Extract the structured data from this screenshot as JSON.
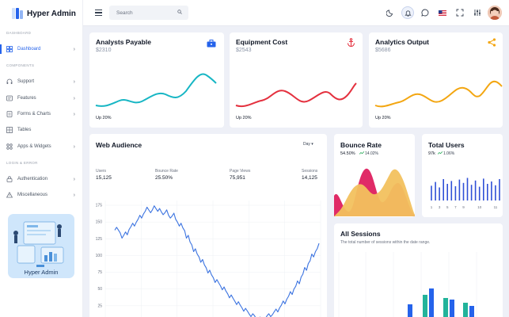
{
  "app": {
    "name": "Hyper Admin"
  },
  "sidebar": {
    "section_dashboard": "DASHBOARD",
    "section_components": "COMPONENTS",
    "section_login": "LOGIN & ERROR",
    "items": [
      {
        "label": "Dashboard",
        "icon": "dashboard-icon"
      },
      {
        "label": "Support",
        "icon": "headset-icon"
      },
      {
        "label": "Features",
        "icon": "features-icon"
      },
      {
        "label": "Forms & Charts",
        "icon": "forms-icon"
      },
      {
        "label": "Tables",
        "icon": "table-icon"
      },
      {
        "label": "Apps & Widgets",
        "icon": "apps-icon"
      },
      {
        "label": "Authentication",
        "icon": "lock-icon"
      },
      {
        "label": "Miscellaneous",
        "icon": "warning-icon"
      }
    ],
    "promo_title": "Hyper Admin"
  },
  "topbar": {
    "search_placeholder": "Search"
  },
  "cards": {
    "analysts": {
      "title": "Analysts Payable",
      "value": "$2310",
      "foot": "Up 20%",
      "color": "#17b6c4"
    },
    "equipment": {
      "title": "Equipment Cost",
      "value": "$2543",
      "foot": "Up 20%",
      "color": "#e4313f"
    },
    "analytics": {
      "title": "Analytics Output",
      "value": "$5686",
      "foot": "Up 20%",
      "color": "#f3a611"
    }
  },
  "web_audience": {
    "title": "Web Audience",
    "range": "Day",
    "stats": [
      {
        "label": "Users",
        "value": "15,125"
      },
      {
        "label": "Bounce Rate",
        "value": "25.50%"
      },
      {
        "label": "Page Views",
        "value": "75,951"
      },
      {
        "label": "Sessions",
        "value": "14,125"
      }
    ]
  },
  "bounce_rate": {
    "title": "Bounce Rate",
    "value": "54.50%",
    "change": "14.02%"
  },
  "total_users": {
    "title": "Total Users",
    "value": "97k",
    "change": "1.06%"
  },
  "all_sessions": {
    "title": "All Sessions",
    "subtitle": "The total number of sessions within the date range."
  },
  "chart_data": [
    {
      "type": "line",
      "name": "web-audience",
      "ylim": [
        0,
        175
      ],
      "yticks": [
        175,
        150,
        125,
        100,
        75,
        50,
        25,
        0
      ],
      "color": "#3b73e0",
      "values": [
        140,
        136,
        128,
        133,
        141,
        146,
        152,
        158,
        164,
        170,
        166,
        172,
        168,
        163,
        166,
        158,
        161,
        152,
        146,
        139,
        128,
        118,
        108,
        100,
        92,
        84,
        76,
        69,
        62,
        57,
        51,
        45,
        39,
        34,
        29,
        24,
        19,
        15,
        11,
        8,
        6,
        5,
        8,
        11,
        14,
        18,
        24,
        30,
        37,
        44,
        52,
        60,
        70,
        80,
        90,
        100,
        108,
        116
      ]
    },
    {
      "type": "bar",
      "name": "total-users",
      "categories": [
        "1",
        "2",
        "3",
        "4",
        "5",
        "6",
        "7",
        "8",
        "9",
        "10",
        "11",
        "12",
        "13",
        "14",
        "15",
        "16",
        "17",
        "18"
      ],
      "xticks": [
        "1",
        "3",
        "5",
        "7",
        "9",
        "10",
        "11"
      ],
      "values": [
        0.62,
        0.78,
        0.55,
        0.9,
        0.7,
        0.82,
        0.6,
        0.88,
        0.74,
        0.95,
        0.66,
        0.84,
        0.58,
        0.92,
        0.7,
        0.8,
        0.64,
        0.9
      ],
      "color": "#2f4fd6"
    }
  ]
}
